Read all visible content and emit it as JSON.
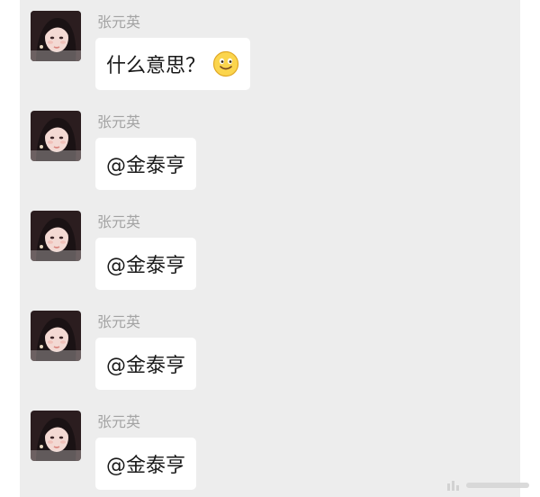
{
  "messages": [
    {
      "sender": "张元英",
      "text": "什么意思？",
      "emoji": "smile-icon"
    },
    {
      "sender": "张元英",
      "text": "@金泰亨"
    },
    {
      "sender": "张元英",
      "text": "@金泰亨"
    },
    {
      "sender": "张元英",
      "text": "@金泰亨"
    },
    {
      "sender": "张元英",
      "text": "@金泰亨"
    }
  ],
  "colors": {
    "panel_bg": "#ededed",
    "bubble_bg": "#ffffff",
    "sender_text": "#a3a3a3",
    "message_text": "#191919"
  }
}
